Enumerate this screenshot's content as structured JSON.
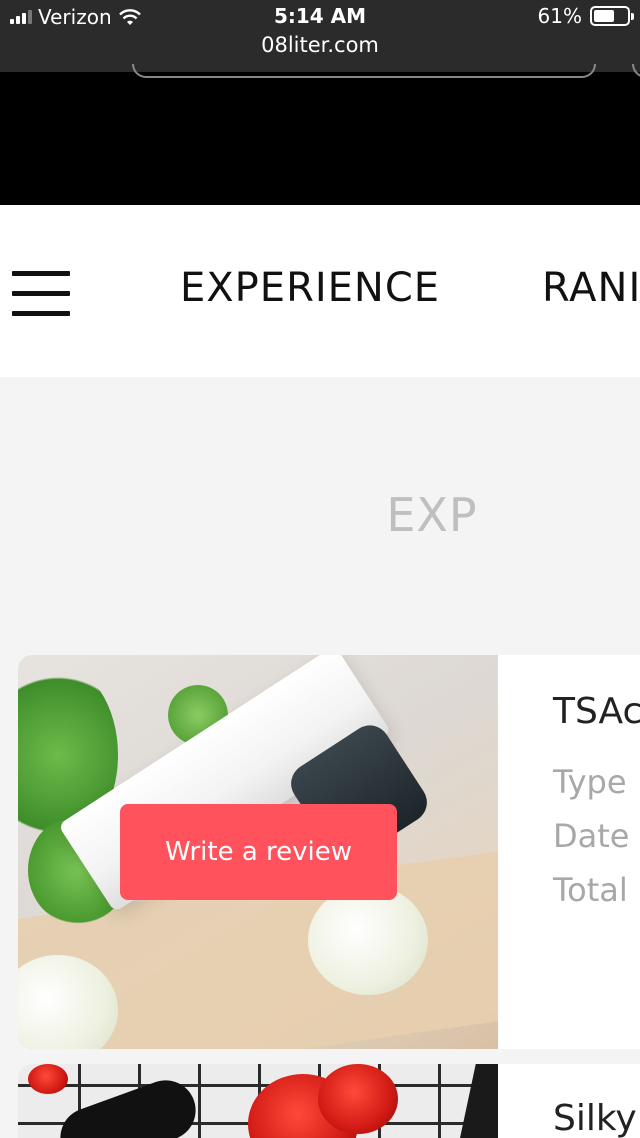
{
  "status_bar": {
    "carrier": "Verizon",
    "time": "5:14 AM",
    "url": "08liter.com",
    "battery": "61%",
    "battery_level": 0.61
  },
  "nav": {
    "menu_icon": "hamburger-menu-icon",
    "items": [
      {
        "label": "EXPERIENCE"
      },
      {
        "label": "RANI"
      }
    ]
  },
  "section": {
    "title": "EXP"
  },
  "cards": [
    {
      "action_label": "Write a review",
      "title": "TSAc",
      "fields": [
        "Type",
        "Date",
        "Total"
      ]
    },
    {
      "title": "Silky"
    }
  ],
  "colors": {
    "review_button": "#ff525c",
    "section_title": "#bfbfbf",
    "field_label": "#a8a8a8"
  }
}
